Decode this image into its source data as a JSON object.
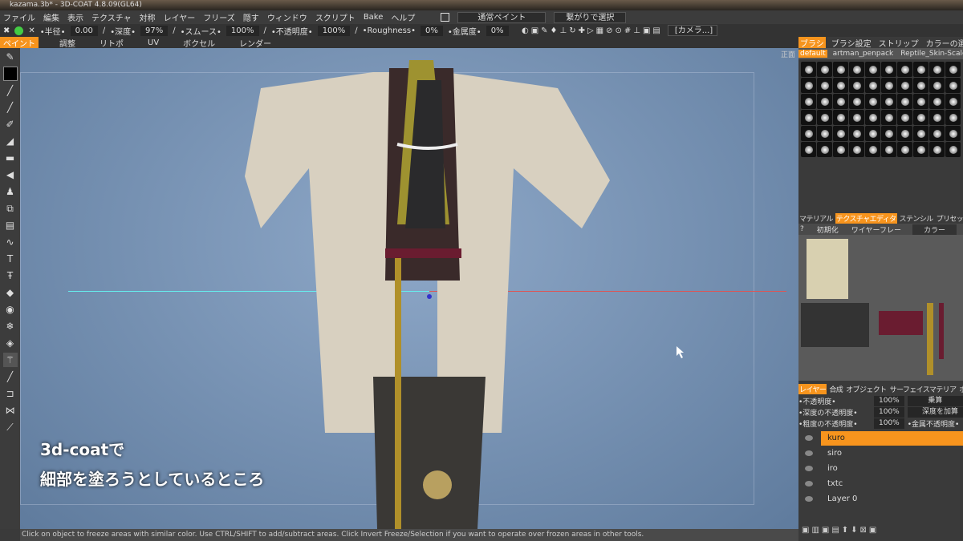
{
  "title": "kazama.3b* - 3D-COAT 4.8.09(GL64)",
  "menu": [
    "ファイル",
    "編集",
    "表示",
    "テクスチャ",
    "対称",
    "レイヤー",
    "フリーズ",
    "隠す",
    "ウィンドウ",
    "スクリプト",
    "Bake",
    "ヘルプ"
  ],
  "paint_mode": "通常ペイント",
  "select_mode": "繋がりで選択",
  "toolbar": {
    "radius_label": "•半径•",
    "radius": "0.00",
    "depth_label": "•深度•",
    "depth": "97%",
    "smooth_label": "•スムース•",
    "smooth": "100%",
    "opacity_label": "•不透明度•",
    "opacity": "100%",
    "roughness_label": "•Roughness•",
    "roughness": "0%",
    "metal_label": "•金属度•",
    "metal": "0%"
  },
  "mode_tabs": [
    "ペイント",
    "調整",
    "リトポ",
    "UV",
    "ボクセル",
    "レンダー"
  ],
  "camera": "[カメラ...]",
  "view_label": "正面",
  "brush_tabs": [
    "ブラシ",
    "ブラシ設定",
    "ストリップ",
    "カラーの選択"
  ],
  "brush_sets": [
    "default",
    "artman_penpack",
    "Reptile_Skin-Scales"
  ],
  "panel_tabs": [
    "マテリアル",
    "テクスチャエディタ",
    "ステンシル",
    "プリセット"
  ],
  "tex_toolbar": [
    "?",
    "初期化",
    "ワイヤーフレー",
    "カラー"
  ],
  "layer_tabs": [
    "レイヤー",
    "合成",
    "オブジェクト",
    "サーフェイスマテリア",
    "ポ"
  ],
  "layer_props": [
    {
      "label": "•不透明度•",
      "value": "100%",
      "extra": "乗算"
    },
    {
      "label": "•深度の不透明度•",
      "value": "100%",
      "extra": "深度を加算"
    },
    {
      "label": "•粗度の不透明度•",
      "value": "100%",
      "extra": "•金属不透明度•"
    }
  ],
  "layers": [
    "kuro",
    "siro",
    "iro",
    "txtc",
    "Layer 0"
  ],
  "caption": [
    "3d-coatで",
    "細部を塗ろうとしているところ"
  ],
  "status": "Click on object to freeze areas with similar color. Use CTRL/SHIFT to add/subtract areas. Click Invert Freeze/Selection if you want to operate over frozen areas in other tools."
}
